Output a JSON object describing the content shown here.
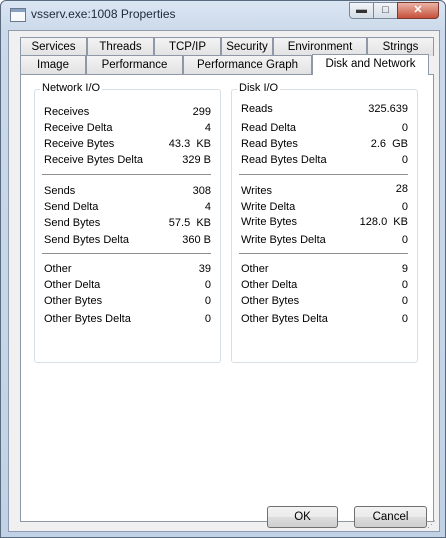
{
  "window": {
    "title": "vsserv.exe:1008 Properties"
  },
  "controls": {
    "minimize": "▬",
    "maximize": "□",
    "close": "✕"
  },
  "tabs": {
    "row1": [
      "Services",
      "Threads",
      "TCP/IP",
      "Security",
      "Environment",
      "Strings"
    ],
    "row2": [
      "Image",
      "Performance",
      "Performance Graph",
      "Disk and Network"
    ],
    "active": "Disk and Network"
  },
  "network": {
    "title": "Network I/O",
    "receives": {
      "label": "Receives",
      "value": "299"
    },
    "receive_delta": {
      "label": "Receive Delta",
      "value": "4"
    },
    "receive_bytes": {
      "label": "Receive Bytes",
      "value": "43.3  KB"
    },
    "receive_bytes_delta": {
      "label": "Receive Bytes Delta",
      "value": "329 B"
    },
    "sends": {
      "label": "Sends",
      "value": "308"
    },
    "send_delta": {
      "label": "Send Delta",
      "value": "4"
    },
    "send_bytes": {
      "label": "Send Bytes",
      "value": "57.5  KB"
    },
    "send_bytes_delta": {
      "label": "Send Bytes Delta",
      "value": "360 B"
    },
    "other": {
      "label": "Other",
      "value": "39"
    },
    "other_delta": {
      "label": "Other Delta",
      "value": "0"
    },
    "other_bytes": {
      "label": "Other Bytes",
      "value": "0"
    },
    "other_bytes_delta": {
      "label": "Other Bytes Delta",
      "value": "0"
    }
  },
  "disk": {
    "title": "Disk I/O",
    "reads": {
      "label": "Reads",
      "value": "325.639"
    },
    "read_delta": {
      "label": "Read Delta",
      "value": "0"
    },
    "read_bytes": {
      "label": "Read Bytes",
      "value": "2.6  GB"
    },
    "read_bytes_delta": {
      "label": "Read Bytes Delta",
      "value": "0"
    },
    "writes": {
      "label": "Writes",
      "value": "28"
    },
    "write_delta": {
      "label": "Write Delta",
      "value": "0"
    },
    "write_bytes": {
      "label": "Write Bytes",
      "value": "128.0  KB"
    },
    "write_bytes_delta": {
      "label": "Write Bytes Delta",
      "value": "0"
    },
    "other": {
      "label": "Other",
      "value": "9"
    },
    "other_delta": {
      "label": "Other Delta",
      "value": "0"
    },
    "other_bytes": {
      "label": "Other Bytes",
      "value": "0"
    },
    "other_bytes_delta": {
      "label": "Other Bytes Delta",
      "value": "0"
    }
  },
  "buttons": {
    "ok": "OK",
    "cancel": "Cancel"
  }
}
